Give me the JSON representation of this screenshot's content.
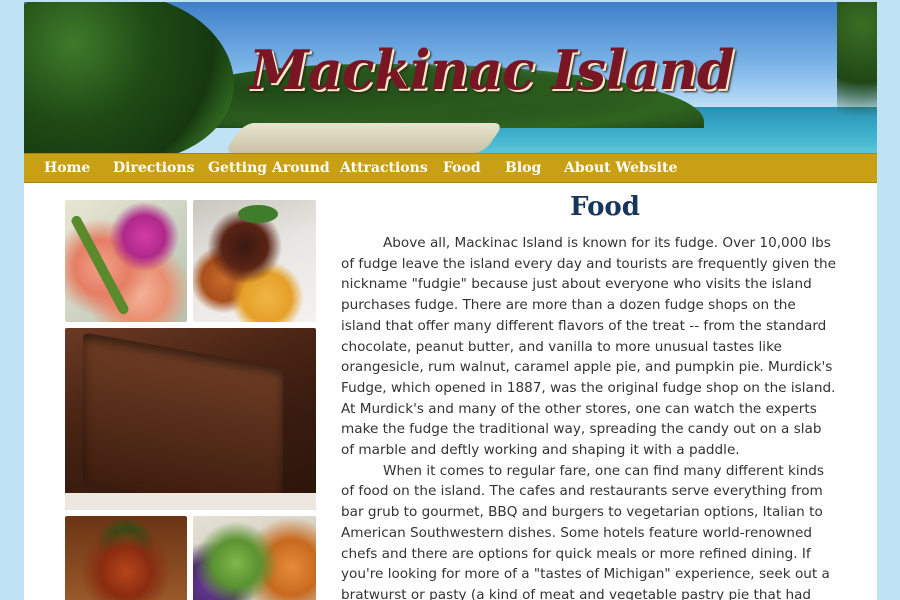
{
  "site": {
    "title": "Mackinac Island"
  },
  "nav": {
    "items": [
      {
        "label": "Home"
      },
      {
        "label": "Directions"
      },
      {
        "label": "Getting Around"
      },
      {
        "label": "Attractions"
      },
      {
        "label": "Food"
      },
      {
        "label": "Blog"
      },
      {
        "label": "About Website"
      }
    ]
  },
  "main": {
    "heading": "Food",
    "paragraphs": [
      "Above all, Mackinac Island is known for its fudge. Over 10,000 lbs of fudge leave the island every day and tourists are frequently given the nickname \"fudgie\" because just about everyone who visits the island purchases fudge. There are more than a dozen fudge shops on the island that offer many different flavors of the treat -- from the standard chocolate, peanut butter, and vanilla to more unusual tastes like orangesicle, rum walnut, caramel apple pie, and pumpkin pie. Murdick's Fudge, which opened in 1887, was the original fudge shop on the island. At Murdick's and many of the other stores, one can watch the experts make the fudge the traditional way, spreading the candy out on a slab of marble and deftly working and shaping it with a paddle.",
      "When it comes to regular fare, one can find many different kinds of food on the island. The cafes and restaurants serve everything from bar grub to gourmet, BBQ and burgers to vegetarian options, Italian to American Southwestern dishes. Some hotels feature world-renowned chefs and there are options for quick meals or more refined dining. If you're looking for more of a \"tastes of Michigan\" experience, seek out a bratwurst or pasty (a kind of meat and vegetable pastry pie that had been"
    ]
  },
  "colors": {
    "page_background": "#bfe2f5",
    "nav_background": "#c9a014",
    "title_color": "#7a1524",
    "heading_color": "#17365d"
  }
}
